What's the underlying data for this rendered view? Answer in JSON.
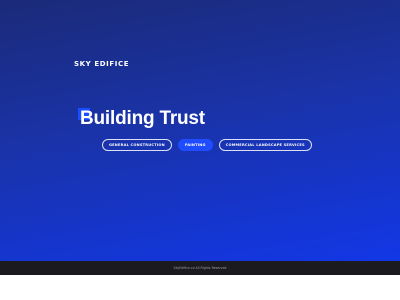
{
  "brand": {
    "name": "SKY EDIFICE"
  },
  "hero": {
    "headline": "Building Trust",
    "categories": [
      {
        "label": "GENERAL CONSTRUCTION",
        "active": false
      },
      {
        "label": "PAINTING",
        "active": true
      },
      {
        "label": "COMMERCIAL LANDSCAPE SERVICES",
        "active": false
      }
    ]
  },
  "footer": {
    "text": "SkyEdifice.co  All Rights Reserved"
  },
  "colors": {
    "gradient_start": "#1b2a78",
    "gradient_end": "#1237e6",
    "accent": "#1f4cff",
    "footer_bg": "#1b1b1f"
  }
}
